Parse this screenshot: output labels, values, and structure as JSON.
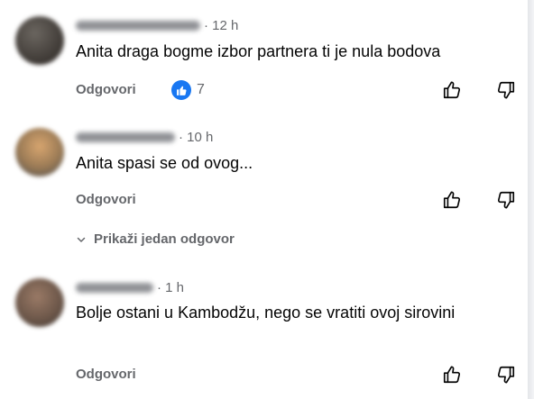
{
  "comments": [
    {
      "time": "· 12 h",
      "text": "Anita draga bogme izbor partnera ti je nula bodova",
      "reply_label": "Odgovori",
      "reaction_count": "7"
    },
    {
      "time": "· 10 h",
      "text": "Anita spasi se od ovog...",
      "reply_label": "Odgovori"
    },
    {
      "time": "· 1 h",
      "text": "Bolje ostani u Kambodžu, nego se vratiti ovoj sirovini",
      "reply_label": "Odgovori"
    }
  ],
  "show_replies_label": "Prikaži jedan odgovor",
  "colors": {
    "like_blue": "#1877f2",
    "muted_text": "#65676b"
  },
  "icons": [
    "thumbs-up-icon",
    "thumbs-down-icon",
    "chevron-down-icon",
    "like-reaction-icon"
  ]
}
